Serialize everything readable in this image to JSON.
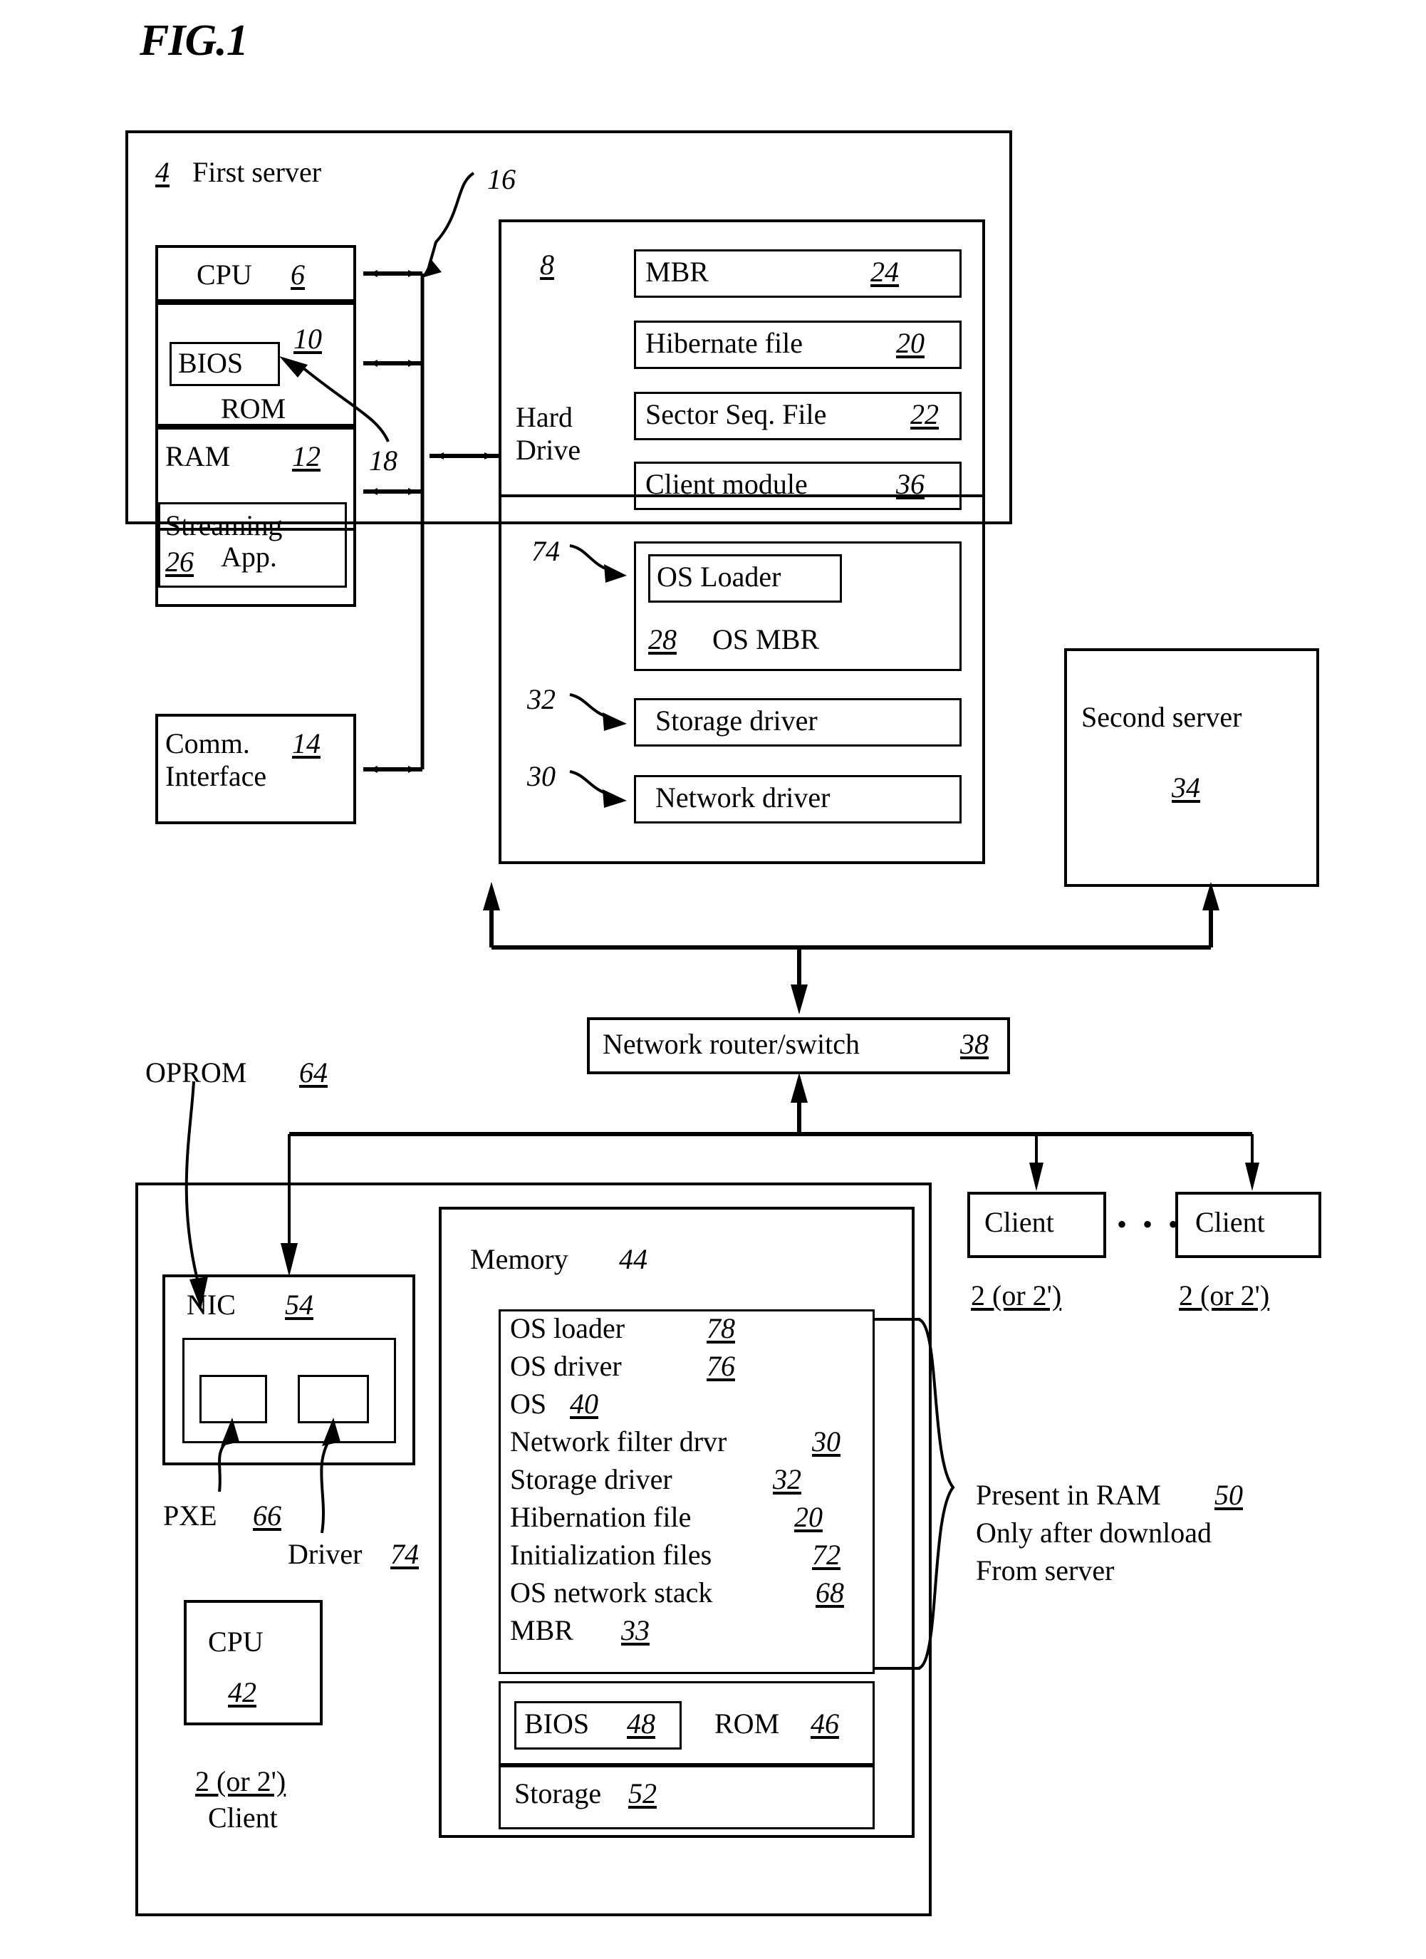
{
  "figure": {
    "title": "FIG.1"
  },
  "first_server": {
    "ref": "4",
    "label": "First server",
    "bus_ref_top": "16",
    "bus_ref_bottom": "18",
    "cpu": {
      "label": "CPU",
      "ref": "6"
    },
    "rom": {
      "label": "ROM",
      "ref": "10",
      "bios_label": "BIOS"
    },
    "ram": {
      "label": "RAM",
      "ref": "12"
    },
    "streaming_app": {
      "line1": "Streaming",
      "line2": "App.",
      "ref": "26"
    },
    "comm_interface": {
      "line1": "Comm.",
      "line2": "Interface",
      "ref": "14"
    },
    "hard_drive": {
      "ref": "8",
      "label_line1": "Hard",
      "label_line2": "Drive",
      "items": [
        {
          "label": "MBR",
          "ref": "24"
        },
        {
          "label": "Hibernate file",
          "ref": "20"
        },
        {
          "label": "Sector Seq. File",
          "ref": "22"
        },
        {
          "label": "Client module",
          "ref": "36"
        }
      ],
      "os_group": {
        "loader_label": "OS Loader",
        "loader_callout_ref": "74",
        "mbr_ref": "28",
        "mbr_label": "OS MBR"
      },
      "storage_driver": {
        "label": "Storage driver",
        "callout_ref": "32"
      },
      "network_driver": {
        "label": "Network driver",
        "callout_ref": "30"
      }
    }
  },
  "second_server": {
    "label": "Second server",
    "ref": "34"
  },
  "router": {
    "label": "Network router/switch",
    "ref": "38"
  },
  "clients_top": [
    {
      "label": "Client",
      "ref": "2 (or 2')"
    },
    {
      "label": "Client",
      "ref": "2 (or 2')"
    }
  ],
  "client_ellipsis": "• • •",
  "client_main": {
    "oprom": {
      "label": "OPROM",
      "ref": "64"
    },
    "nic": {
      "label": "NIC",
      "ref": "54"
    },
    "pxe": {
      "label": "PXE",
      "ref": "66"
    },
    "driver": {
      "label": "Driver",
      "ref": "74"
    },
    "cpu": {
      "label": "CPU",
      "ref": "42"
    },
    "client_ref": "2 (or 2')",
    "client_label": "Client",
    "memory": {
      "label": "Memory",
      "ref": "44",
      "ram_items": [
        {
          "label": "OS loader",
          "ref": "78"
        },
        {
          "label": "OS driver",
          "ref": "76"
        },
        {
          "label": "OS",
          "ref": "40"
        },
        {
          "label": "Network filter drvr",
          "ref": "30"
        },
        {
          "label": "Storage driver",
          "ref": "32"
        },
        {
          "label": "Hibernation file",
          "ref": "20"
        },
        {
          "label": "Initialization files",
          "ref": "72"
        },
        {
          "label": "OS network stack",
          "ref": "68"
        },
        {
          "label": "MBR",
          "ref": "33"
        }
      ],
      "rom": {
        "label": "ROM",
        "ref": "46",
        "bios_label": "BIOS",
        "bios_ref": "48"
      },
      "storage": {
        "label": "Storage",
        "ref": "52"
      }
    },
    "annotation": {
      "line1_text": "Present in RAM",
      "line1_ref": "50",
      "line2": "Only after download",
      "line3": "From server"
    }
  }
}
